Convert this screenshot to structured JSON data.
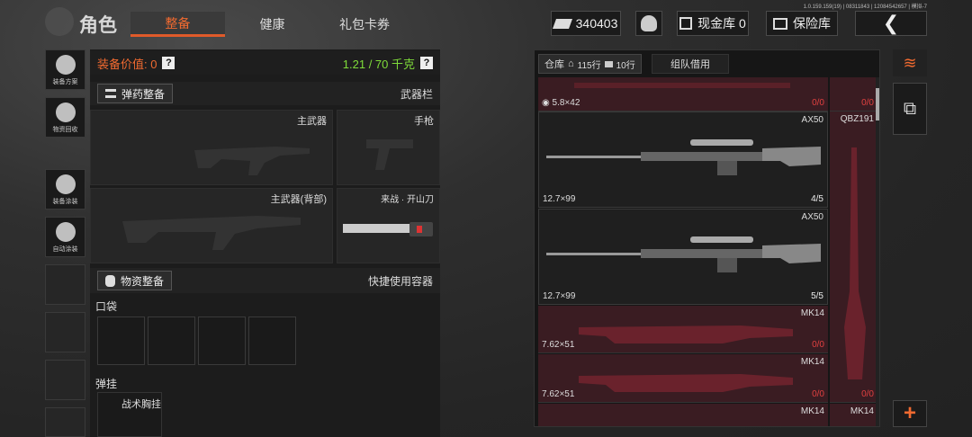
{
  "version": "1.0.159.159(19) | 08311843 | 12084542657 | 模拟-7",
  "header": {
    "title": "角色",
    "tabs": [
      "整备",
      "健康",
      "礼包卡券"
    ],
    "currency": "340403",
    "cash_vault": "现金库 0",
    "safe_box": "保险库"
  },
  "rail": [
    {
      "label": "装备方案"
    },
    {
      "label": "物资回收"
    },
    {
      "label": "装备涂装"
    },
    {
      "label": "自动涂装"
    }
  ],
  "loadout": {
    "value_label": "装备价值: 0",
    "weight": "1.21 / 70 千克",
    "ammo_button": "弹药整备",
    "weapon_bar": "武器栏",
    "primary": "主武器",
    "pistol": "手枪",
    "primary_back": "主武器(背部)",
    "melee": "来战 · 开山刀",
    "supply_button": "物资整备",
    "quick_container": "快捷使用容器",
    "pocket": "口袋",
    "rig_label": "弹挂",
    "rig_item": "战术胸挂"
  },
  "storage": {
    "tab_store": "仓库",
    "rows_a": "115行",
    "rows_b": "10行",
    "tab_team": "组队借用",
    "items": [
      {
        "caliber": "5.8×42",
        "name": "",
        "count": "0/0",
        "style": "red"
      },
      {
        "caliber": "12.7×99",
        "name": "AX50",
        "count": "4/5",
        "style": "dark"
      },
      {
        "caliber": "12.7×99",
        "name": "AX50",
        "count": "5/5",
        "style": "dark"
      },
      {
        "caliber": "7.62×51",
        "name": "MK14",
        "count": "0/0",
        "style": "red"
      },
      {
        "caliber": "7.62×51",
        "name": "MK14",
        "count": "0/0",
        "style": "red"
      },
      {
        "caliber": "",
        "name": "MK14",
        "count": "",
        "style": "red"
      }
    ],
    "side_items": [
      {
        "name": "",
        "count": "0/0"
      },
      {
        "name": "QBZ191",
        "count": "0/0"
      },
      {
        "name": "MK14",
        "count": ""
      }
    ]
  },
  "colors": {
    "accent": "#f06a30",
    "weight_green": "#7fdc3a",
    "alert_red": "#e04040"
  }
}
